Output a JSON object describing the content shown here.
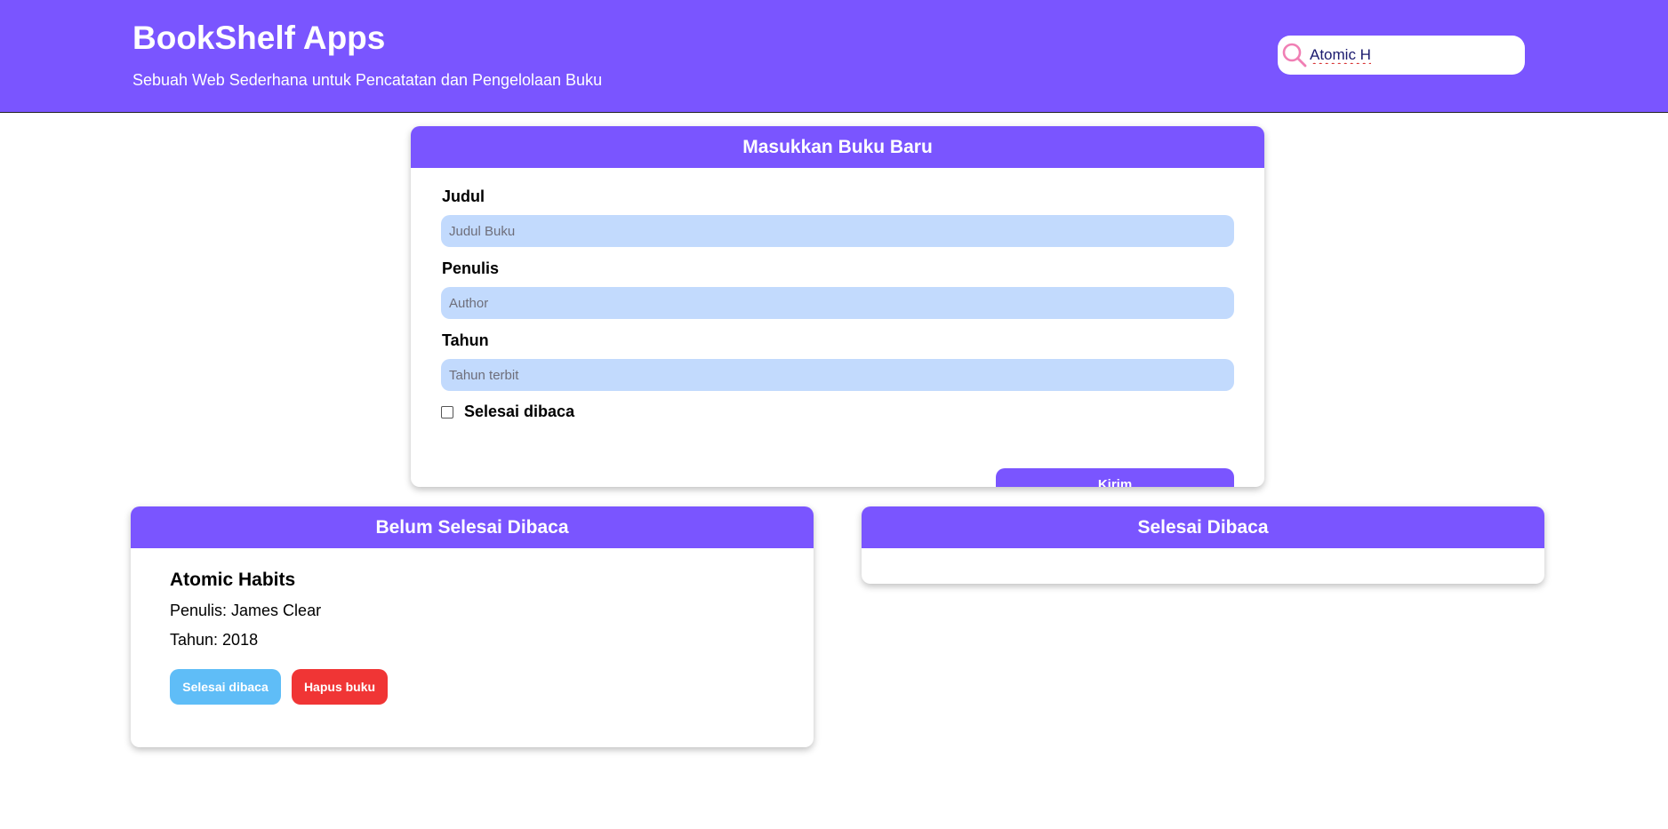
{
  "header": {
    "title": "BookShelf Apps",
    "subtitle": "Sebuah Web Sederhana untuk Pencatatan dan Pengelolaan Buku",
    "search_value": "Atomic H",
    "search_icon": "search-icon"
  },
  "form": {
    "heading": "Masukkan Buku Baru",
    "title_label": "Judul",
    "title_placeholder": "Judul Buku",
    "author_label": "Penulis",
    "author_placeholder": "Author",
    "year_label": "Tahun",
    "year_placeholder": "Tahun terbit",
    "complete_label": "Selesai dibaca",
    "complete_checked": false,
    "submit_label": "Kirim"
  },
  "unread_shelf": {
    "heading": "Belum Selesai Dibaca",
    "books": [
      {
        "title": "Atomic Habits",
        "author": "Penulis: James Clear",
        "year": "Tahun: 2018",
        "done_label": "Selesai dibaca",
        "delete_label": "Hapus buku"
      }
    ]
  },
  "read_shelf": {
    "heading": "Selesai Dibaca",
    "books": []
  },
  "colors": {
    "primary": "#7a55ff",
    "input_bg": "#c2dafd",
    "done_button": "#5fbdf7",
    "delete_button": "#f03535",
    "search_icon": "#f07fb4"
  }
}
